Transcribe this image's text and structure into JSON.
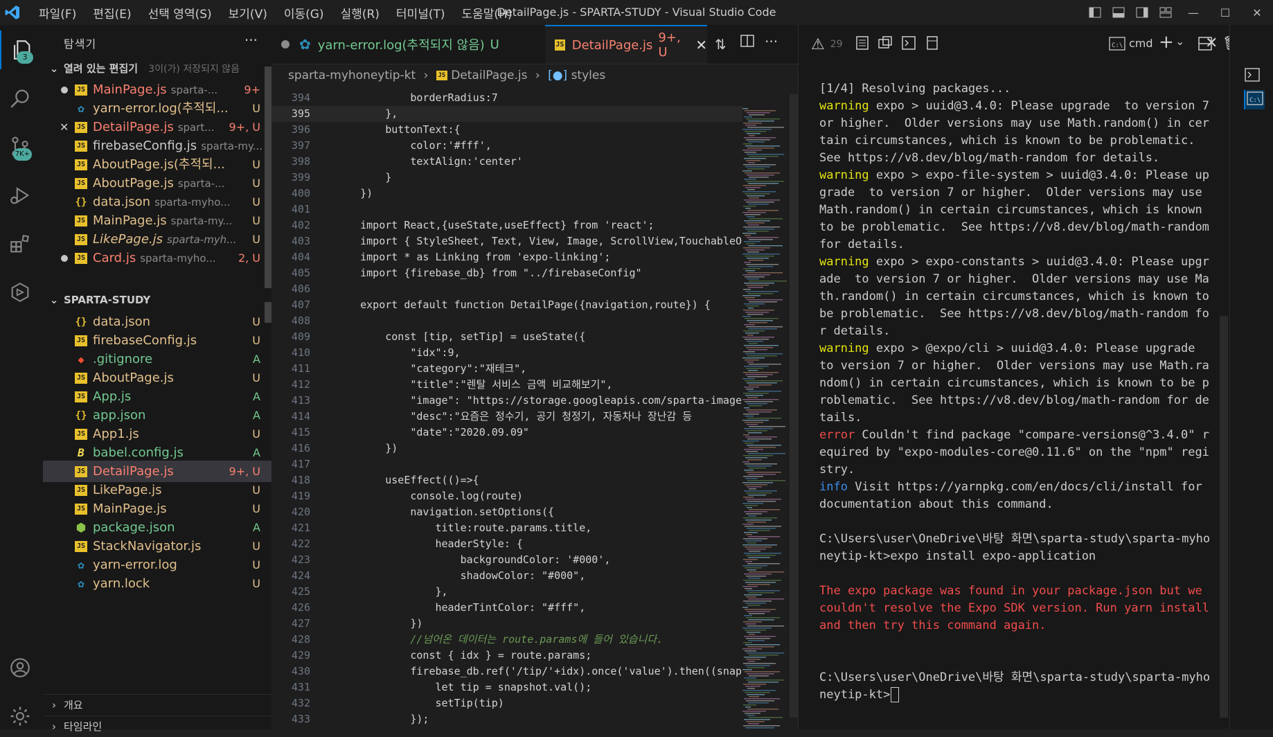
{
  "title_bar": {
    "menu": [
      "파일(F)",
      "편집(E)",
      "선택 영역(S)",
      "보기(V)",
      "이동(G)",
      "실행(R)",
      "터미널(T)",
      "도움말(H)"
    ],
    "window_title": "DetailPage.js - SPARTA-STUDY - Visual Studio Code"
  },
  "activity_bar": {
    "explorer_badge": "3",
    "scm_badge": "7K+"
  },
  "sidebar": {
    "title": "탐색기",
    "more": "···",
    "open_editors": {
      "label": "열려 있는 편집기",
      "unsaved": "3이(가) 저장되지 않음",
      "items": [
        {
          "name": "MainPage.js",
          "desc": "sparta-...",
          "status": "9+",
          "dirty": true,
          "type": "js"
        },
        {
          "name": "yarn-error.log(추적되...",
          "desc": "",
          "status": "U",
          "type": "yarn"
        },
        {
          "name": "DetailPage.js",
          "desc": "spart...",
          "status": "9+, U",
          "close": true,
          "type": "js"
        },
        {
          "name": "firebaseConfig.js",
          "desc": "sparta-my...",
          "status": "",
          "type": "js"
        },
        {
          "name": "AboutPage.js(추적되...",
          "desc": "",
          "status": "U",
          "type": "js"
        },
        {
          "name": "AboutPage.js",
          "desc": "sparta-...",
          "status": "U",
          "type": "js"
        },
        {
          "name": "data.json",
          "desc": "sparta-myho...",
          "status": "U",
          "type": "json"
        },
        {
          "name": "MainPage.js",
          "desc": "sparta-my...",
          "status": "U",
          "type": "js"
        },
        {
          "name": "LikePage.js",
          "desc": "sparta-myh...",
          "status": "U",
          "type": "js",
          "italic": true
        },
        {
          "name": "Card.js",
          "desc": "sparta-myho...",
          "status": "2, U",
          "dirty": true,
          "type": "js"
        }
      ]
    },
    "project": {
      "label": "SPARTA-STUDY",
      "items": [
        {
          "name": "data.json",
          "status": "U",
          "type": "json"
        },
        {
          "name": "firebaseConfig.js",
          "status": "U",
          "type": "js"
        },
        {
          "name": ".gitignore",
          "status": "A",
          "type": "git"
        },
        {
          "name": "AboutPage.js",
          "status": "U",
          "type": "js"
        },
        {
          "name": "App.js",
          "status": "A",
          "type": "js"
        },
        {
          "name": "app.json",
          "status": "A",
          "type": "json"
        },
        {
          "name": "App1.js",
          "status": "U",
          "type": "js"
        },
        {
          "name": "babel.config.js",
          "status": "A",
          "type": "babel"
        },
        {
          "name": "DetailPage.js",
          "status": "9+, U",
          "type": "js",
          "active": true
        },
        {
          "name": "LikePage.js",
          "status": "U",
          "type": "js"
        },
        {
          "name": "MainPage.js",
          "status": "U",
          "type": "js"
        },
        {
          "name": "package.json",
          "status": "A",
          "type": "npm"
        },
        {
          "name": "StackNavigator.js",
          "status": "U",
          "type": "js"
        },
        {
          "name": "yarn-error.log",
          "status": "U",
          "type": "yarn"
        },
        {
          "name": "yarn.lock",
          "status": "U",
          "type": "yarn"
        }
      ]
    },
    "outline_label": "개요",
    "timeline_label": "타임라인"
  },
  "editor": {
    "tabs": [
      {
        "label": "yarn-error.log(추적되지 않음)",
        "suffix": "U"
      },
      {
        "label": "DetailPage.js",
        "suffix": "9+, U"
      }
    ],
    "breadcrumbs": [
      "sparta-myhoneytip-kt",
      "DetailPage.js",
      "styles"
    ],
    "lines": [
      {
        "n": "394",
        "t": "            borderRadius:7"
      },
      {
        "n": "395",
        "t": "        },"
      },
      {
        "n": "396",
        "t": "        buttonText:{"
      },
      {
        "n": "397",
        "t": "            color:'#fff',"
      },
      {
        "n": "398",
        "t": "            textAlign:'center'"
      },
      {
        "n": "399",
        "t": "        }"
      },
      {
        "n": "400",
        "t": "    })"
      },
      {
        "n": "401",
        "t": ""
      },
      {
        "n": "402",
        "t": "    import React,{useState,useEffect} from 'react';"
      },
      {
        "n": "403",
        "t": "    import { StyleSheet, Text, View, Image, ScrollView,TouchableO"
      },
      {
        "n": "404",
        "t": "    import * as Linking from 'expo-linking';"
      },
      {
        "n": "405",
        "t": "    import {firebase_db} from \"../firebaseConfig\""
      },
      {
        "n": "406",
        "t": ""
      },
      {
        "n": "407",
        "t": "    export default function DetailPage({navigation,route}) {"
      },
      {
        "n": "408",
        "t": ""
      },
      {
        "n": "409",
        "t": "        const [tip, setTip] = useState({"
      },
      {
        "n": "410",
        "t": "            \"idx\":9,"
      },
      {
        "n": "411",
        "t": "            \"category\":\"재테크\","
      },
      {
        "n": "412",
        "t": "            \"title\":\"렌탈 서비스 금액 비교해보기\","
      },
      {
        "n": "413",
        "t": "            \"image\": \"https://storage.googleapis.com/sparta-image"
      },
      {
        "n": "414",
        "t": "            \"desc\":\"요즘은 정수기, 공기 청정기, 자동차나 장난감 등"
      },
      {
        "n": "415",
        "t": "            \"date\":\"2020.09.09\""
      },
      {
        "n": "416",
        "t": "        })"
      },
      {
        "n": "417",
        "t": ""
      },
      {
        "n": "418",
        "t": "        useEffect(()=>{"
      },
      {
        "n": "419",
        "t": "            console.log(route)"
      },
      {
        "n": "420",
        "t": "            navigation.setOptions({"
      },
      {
        "n": "421",
        "t": "                title:route.params.title,"
      },
      {
        "n": "422",
        "t": "                headerStyle: {"
      },
      {
        "n": "423",
        "t": "                    backgroundColor: '#000',"
      },
      {
        "n": "424",
        "t": "                    shadowColor: \"#000\","
      },
      {
        "n": "425",
        "t": "                },"
      },
      {
        "n": "426",
        "t": "                headerTintColor: \"#fff\","
      },
      {
        "n": "427",
        "t": "            })"
      },
      {
        "n": "428",
        "t": "            //넘어온 데이터는 route.params에 들어 있습니다."
      },
      {
        "n": "429",
        "t": "            const { idx } = route.params;"
      },
      {
        "n": "430",
        "t": "            firebase_db.ref('/tip/'+idx).once('value').then((snap"
      },
      {
        "n": "431",
        "t": "                let tip = snapshot.val();"
      },
      {
        "n": "432",
        "t": "                setTip(tip)"
      },
      {
        "n": "433",
        "t": "            });"
      }
    ]
  },
  "terminal": {
    "problems_count": "29",
    "shell_label": "cmd",
    "lines": [
      {
        "k": "plain",
        "t": "[1/4] Resolving packages..."
      },
      {
        "k": "warn",
        "p": "warning",
        "t": " expo > uuid@3.4.0: Please upgrade  to version 7 or higher.  Older versions may use Math.random() in certain circumstances, which is known to be problematic.  See https://v8.dev/blog/math-random for details."
      },
      {
        "k": "warn",
        "p": "warning",
        "t": " expo > expo-file-system > uuid@3.4.0: Please upgrade  to version 7 or higher.  Older versions may use Math.random() in certain circumstances, which is known to be problematic.  See https://v8.dev/blog/math-random for details."
      },
      {
        "k": "warn",
        "p": "warning",
        "t": " expo > expo-constants > uuid@3.4.0: Please upgrade  to version 7 or higher.  Older versions may use Math.random() in certain circumstances, which is known to be problematic.  See https://v8.dev/blog/math-random for details."
      },
      {
        "k": "warn",
        "p": "warning",
        "t": " expo > @expo/cli > uuid@3.4.0: Please upgrade  to version 7 or higher.  Older versions may use Math.random() in certain circumstances, which is known to be problematic.  See https://v8.dev/blog/math-random for details."
      },
      {
        "k": "err",
        "p": "error",
        "t": " Couldn't find package \"compare-versions@^3.4.0\" required by \"expo-modules-core@0.11.6\" on the \"npm\" registry."
      },
      {
        "k": "info",
        "p": "info",
        "t": " Visit https://yarnpkg.com/en/docs/cli/install for documentation about this command."
      },
      {
        "k": "plain",
        "t": ""
      },
      {
        "k": "plain",
        "t": "C:\\Users\\user\\OneDrive\\바탕 화면\\sparta-study\\sparta-myhoneytip-kt>expo install expo-application"
      },
      {
        "k": "plain",
        "t": ""
      },
      {
        "k": "red",
        "t": "The expo package was found in your package.json but we couldn't resolve the Expo SDK version. Run yarn install and then try this command again."
      },
      {
        "k": "plain",
        "t": ""
      },
      {
        "k": "plain",
        "t": ""
      },
      {
        "k": "plain",
        "t": "C:\\Users\\user\\OneDrive\\바탕 화면\\sparta-study\\sparta-myhoneytip-kt>"
      }
    ]
  }
}
